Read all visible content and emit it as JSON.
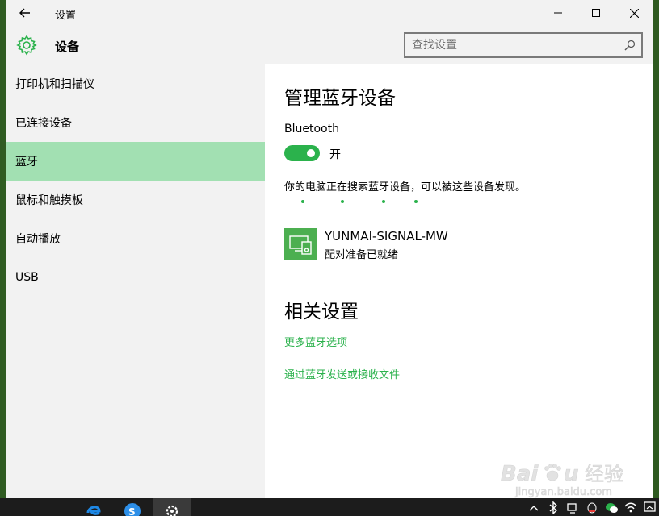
{
  "window": {
    "title": "设置",
    "header_title": "设备"
  },
  "search": {
    "placeholder": "查找设置"
  },
  "sidebar": {
    "items": [
      {
        "label": "打印机和扫描仪"
      },
      {
        "label": "已连接设备"
      },
      {
        "label": "蓝牙"
      },
      {
        "label": "鼠标和触摸板"
      },
      {
        "label": "自动播放"
      },
      {
        "label": "USB"
      }
    ],
    "selected_index": 2
  },
  "main": {
    "title": "管理蓝牙设备",
    "bluetooth_label": "Bluetooth",
    "toggle_state": "开",
    "toggle_on": true,
    "searching_text": "你的电脑正在搜索蓝牙设备，可以被这些设备发现。",
    "device": {
      "name": "YUNMAI-SIGNAL-MW",
      "status": "配对准备已就绪"
    },
    "related_title": "相关设置",
    "links": [
      {
        "label": "更多蓝牙选项"
      },
      {
        "label": "通过蓝牙发送或接收文件"
      }
    ]
  },
  "watermark": {
    "brand": "Baidu",
    "cn": "经验",
    "url": "jingyan.baidu.com"
  },
  "colors": {
    "accent": "#2bb24c",
    "selected_bg": "#a2e0b2",
    "pane_bg": "#f2f2f2",
    "device_tile": "#4caf50"
  },
  "taskbar": {
    "apps": [
      "edge-icon",
      "sogou-browser-icon",
      "settings-icon"
    ],
    "tray": [
      "chevron-up-icon",
      "bluetooth-icon",
      "network-icon",
      "qq-icon",
      "wechat-icon",
      "wifi-icon",
      "notification-icon"
    ]
  }
}
